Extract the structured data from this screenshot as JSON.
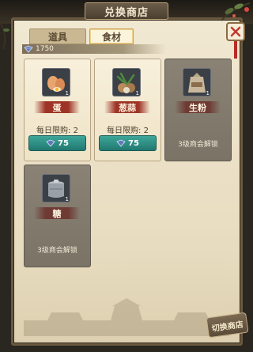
{
  "window": {
    "title": "兑换商店"
  },
  "tabs": [
    {
      "label": "道具",
      "active": false
    },
    {
      "label": "食材",
      "active": true
    }
  ],
  "currency": {
    "icon": "gem-icon",
    "amount": "1750"
  },
  "items": [
    {
      "name": "蛋",
      "qty": "1",
      "icon": "egg-icon",
      "limit": "每日限购: 2",
      "price": "75",
      "locked": false
    },
    {
      "name": "葱蒜",
      "qty": "1",
      "icon": "scallion-garlic-icon",
      "limit": "每日限购: 2",
      "price": "75",
      "locked": false
    },
    {
      "name": "生粉",
      "qty": "1",
      "icon": "flour-sack-icon",
      "locked_text": "3级商会解锁",
      "locked": true
    },
    {
      "name": "糖",
      "qty": "1",
      "icon": "sugar-jar-icon",
      "locked_text": "3级商会解锁",
      "locked": true
    }
  ],
  "switch_button": {
    "label": "切换商店"
  },
  "colors": {
    "accent_teal": "#21786f",
    "ribbon_red": "#9e3428",
    "panel_bg": "#f1e8d2",
    "locked_bg": "#7b7466"
  }
}
